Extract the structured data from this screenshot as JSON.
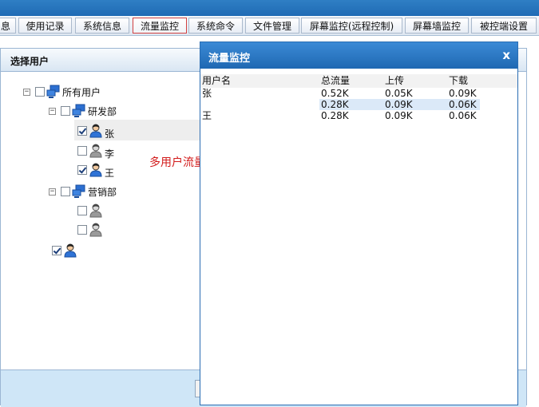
{
  "tabs": [
    "息",
    "使用记录",
    "系统信息",
    "流量监控",
    "系统命令",
    "文件管理",
    "屏幕监控(远程控制)",
    "屏幕墙监控",
    "被控端设置"
  ],
  "active_tab": "流量监控",
  "panel": {
    "title": "选择用户",
    "tree": {
      "root_label": "所有用户",
      "dept1_label": "研发部",
      "user_zhang": "张",
      "user_li": "李",
      "user_wang": "王",
      "dept2_label": "营销部"
    }
  },
  "annotation": "多用户流量监控",
  "dialog": {
    "title": "流量监控",
    "close": "x",
    "columns": [
      "用户名",
      "总流量",
      "上传",
      "下载"
    ],
    "rows": [
      [
        "张",
        "0.52K",
        "0.05K",
        "0.09K"
      ],
      [
        "",
        "0.28K",
        "0.09K",
        "0.06K"
      ],
      [
        "王",
        "0.28K",
        "0.09K",
        "0.06K"
      ]
    ]
  },
  "colors": {
    "accent": "#1f68b2",
    "annotation": "#d21b1b",
    "footer": "#cfe6f7"
  }
}
